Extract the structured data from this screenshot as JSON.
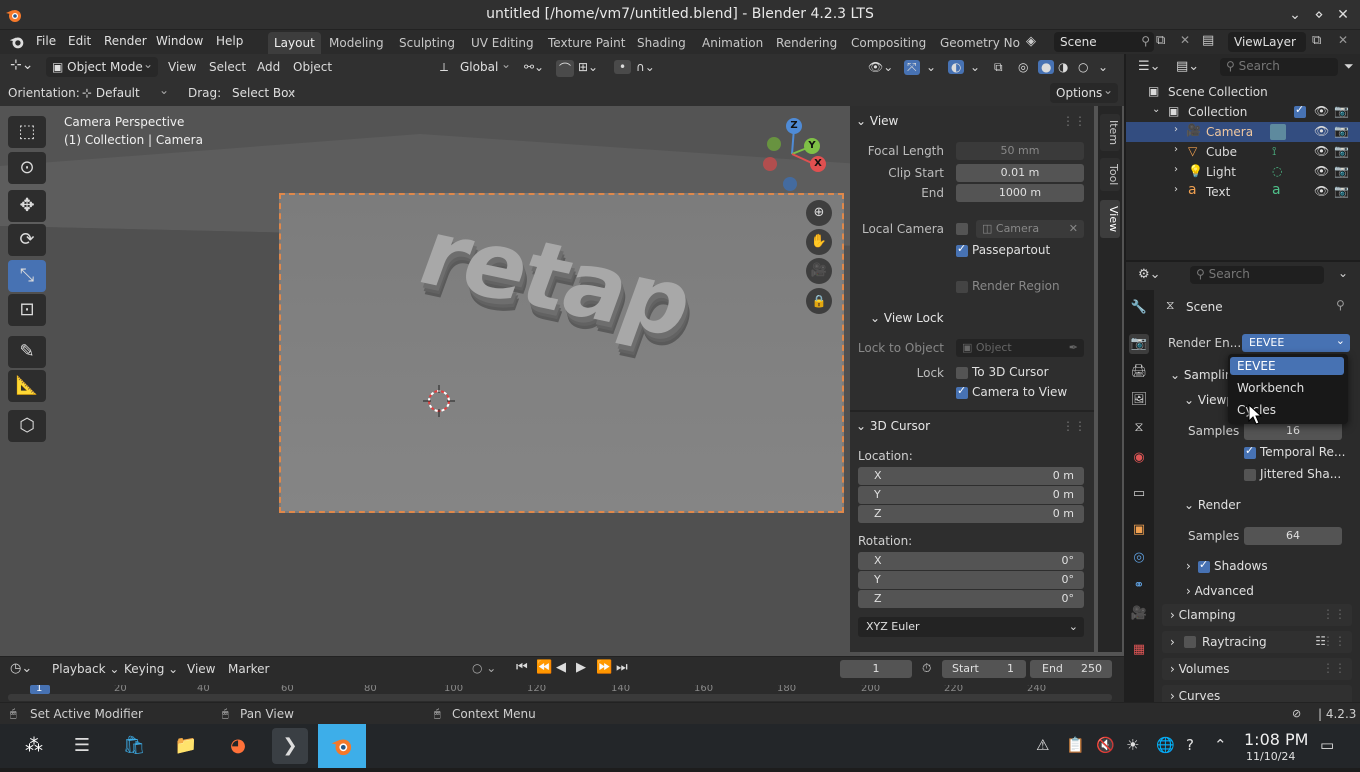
{
  "window": {
    "title": "untitled [/home/vm7/untitled.blend] - Blender 4.2.3 LTS",
    "controls": [
      "⌄",
      "⋄",
      "✕"
    ]
  },
  "menubar": {
    "items": [
      "File",
      "Edit",
      "Render",
      "Window",
      "Help"
    ],
    "workspaces": [
      "Layout",
      "Modeling",
      "Sculpting",
      "UV Editing",
      "Texture Paint",
      "Shading",
      "Animation",
      "Rendering",
      "Compositing",
      "Geometry Noc"
    ],
    "active_workspace": "Layout",
    "scene": "Scene",
    "view_layer": "ViewLayer"
  },
  "viewport_header": {
    "mode": "Object Mode",
    "menus": [
      "View",
      "Select",
      "Add",
      "Object"
    ],
    "transform_orientation": "Global",
    "orientation_label": "Orientation:",
    "orientation_value": "Default",
    "drag_label": "Drag:",
    "drag_value": "Select Box",
    "options": "Options"
  },
  "viewport": {
    "overlay_line1": "Camera Perspective",
    "overlay_line2": "(1) Collection | Camera",
    "text_object": "retap",
    "gizmo_axes": {
      "x": "X",
      "y": "Y",
      "z": "Z"
    }
  },
  "npanel": {
    "tabs": [
      "Item",
      "Tool",
      "View"
    ],
    "active_tab": "View",
    "view_section": "View",
    "focal_length_label": "Focal Length",
    "focal_length": "50 mm",
    "clip_start_label": "Clip Start",
    "clip_start": "0.01 m",
    "clip_end_label": "End",
    "clip_end": "1000 m",
    "local_camera_label": "Local Camera",
    "local_camera_value": "Camera",
    "passepartout": "Passepartout",
    "render_region": "Render Region",
    "view_lock_section": "View Lock",
    "lock_to_object_label": "Lock to Object",
    "lock_to_object_placeholder": "Object",
    "lock_label": "Lock",
    "to_3d_cursor": "To 3D Cursor",
    "camera_to_view": "Camera to View",
    "cursor_section": "3D Cursor",
    "location_label": "Location:",
    "loc": {
      "x_label": "X",
      "x": "0 m",
      "y_label": "Y",
      "y": "0 m",
      "z_label": "Z",
      "z": "0 m"
    },
    "rotation_label": "Rotation:",
    "rot": {
      "x_label": "X",
      "x": "0°",
      "y_label": "Y",
      "y": "0°",
      "z_label": "Z",
      "z": "0°"
    },
    "rotation_mode": "XYZ Euler"
  },
  "timeline": {
    "menus": [
      "Playback",
      "Keying",
      "View",
      "Marker"
    ],
    "current_frame": "1",
    "start_label": "Start",
    "start": "1",
    "end_label": "End",
    "end": "250",
    "ruler": [
      "1",
      "20",
      "40",
      "60",
      "80",
      "100",
      "120",
      "140",
      "160",
      "180",
      "200",
      "220",
      "240"
    ]
  },
  "outliner": {
    "search_placeholder": "Search",
    "root": "Scene Collection",
    "collection": "Collection",
    "items": [
      {
        "name": "Camera",
        "icon": "camera-icon",
        "color": "#f0a080",
        "selected": true
      },
      {
        "name": "Cube",
        "icon": "mesh-icon",
        "color": "#f0a050",
        "selected": false
      },
      {
        "name": "Light",
        "icon": "light-icon",
        "color": "#f0a050",
        "selected": false
      },
      {
        "name": "Text",
        "icon": "text-icon",
        "color": "#f0a050",
        "selected": false
      }
    ]
  },
  "properties": {
    "search_placeholder": "Search",
    "scene_label": "Scene",
    "render_engine_label": "Render En...",
    "render_engine_value": "EEVEE",
    "sampling": "Sampling",
    "viewport_sub": "Viewp",
    "samples_label": "Samples",
    "viewport_samples": "16",
    "temporal": "Temporal Re...",
    "jittered": "Jittered Sha...",
    "render_sub": "Render",
    "render_samples_label": "Samples",
    "render_samples": "64",
    "shadows": "Shadows",
    "advanced": "Advanced",
    "clamping": "Clamping",
    "raytracing": "Raytracing",
    "volumes": "Volumes",
    "curves": "Curves"
  },
  "engine_dropdown": {
    "options": [
      "EEVEE",
      "Workbench",
      "Cycles"
    ],
    "highlighted": "EEVEE"
  },
  "statusbar": {
    "left": "Set Active Modifier",
    "middle": "Pan View",
    "right": "Context Menu",
    "version": "4.2.3"
  },
  "taskbar": {
    "time": "1:08 PM",
    "date": "11/10/24"
  },
  "colors": {
    "accent": "#4772b3",
    "selection": "#334d80",
    "viewport_bg": "#545454"
  }
}
